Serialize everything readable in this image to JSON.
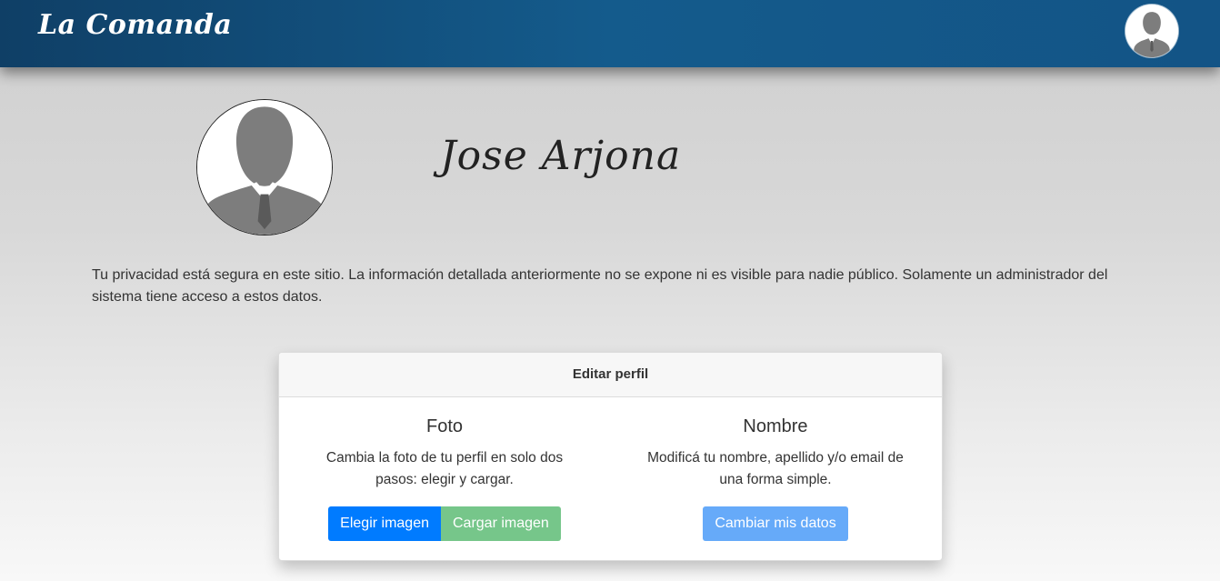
{
  "navbar": {
    "brand": "La Comanda",
    "avatar_icon": "user-silhouette-icon"
  },
  "profile": {
    "name": "Jose Arjona",
    "avatar_icon": "user-silhouette-icon"
  },
  "privacy_text": "Tu privacidad está segura en este sitio. La información detallada anteriormente no se expone ni es visible para nadie público. Solamente un administrador del sistema tiene acceso a estos datos.",
  "edit_card": {
    "title": "Editar perfil",
    "photo": {
      "heading": "Foto",
      "description": "Cambia la foto de tu perfil en solo dos pasos: elegir y cargar.",
      "choose_label": "Elegir imagen",
      "upload_label": "Cargar imagen"
    },
    "name": {
      "heading": "Nombre",
      "description": "Modificá tu nombre, apellido y/o email de una forma simple.",
      "change_label": "Cambiar mis datos"
    }
  },
  "colors": {
    "navbar": "#145b8c",
    "primary": "#007bff",
    "success": "#76c68a",
    "primary_light": "#66aaf9"
  }
}
